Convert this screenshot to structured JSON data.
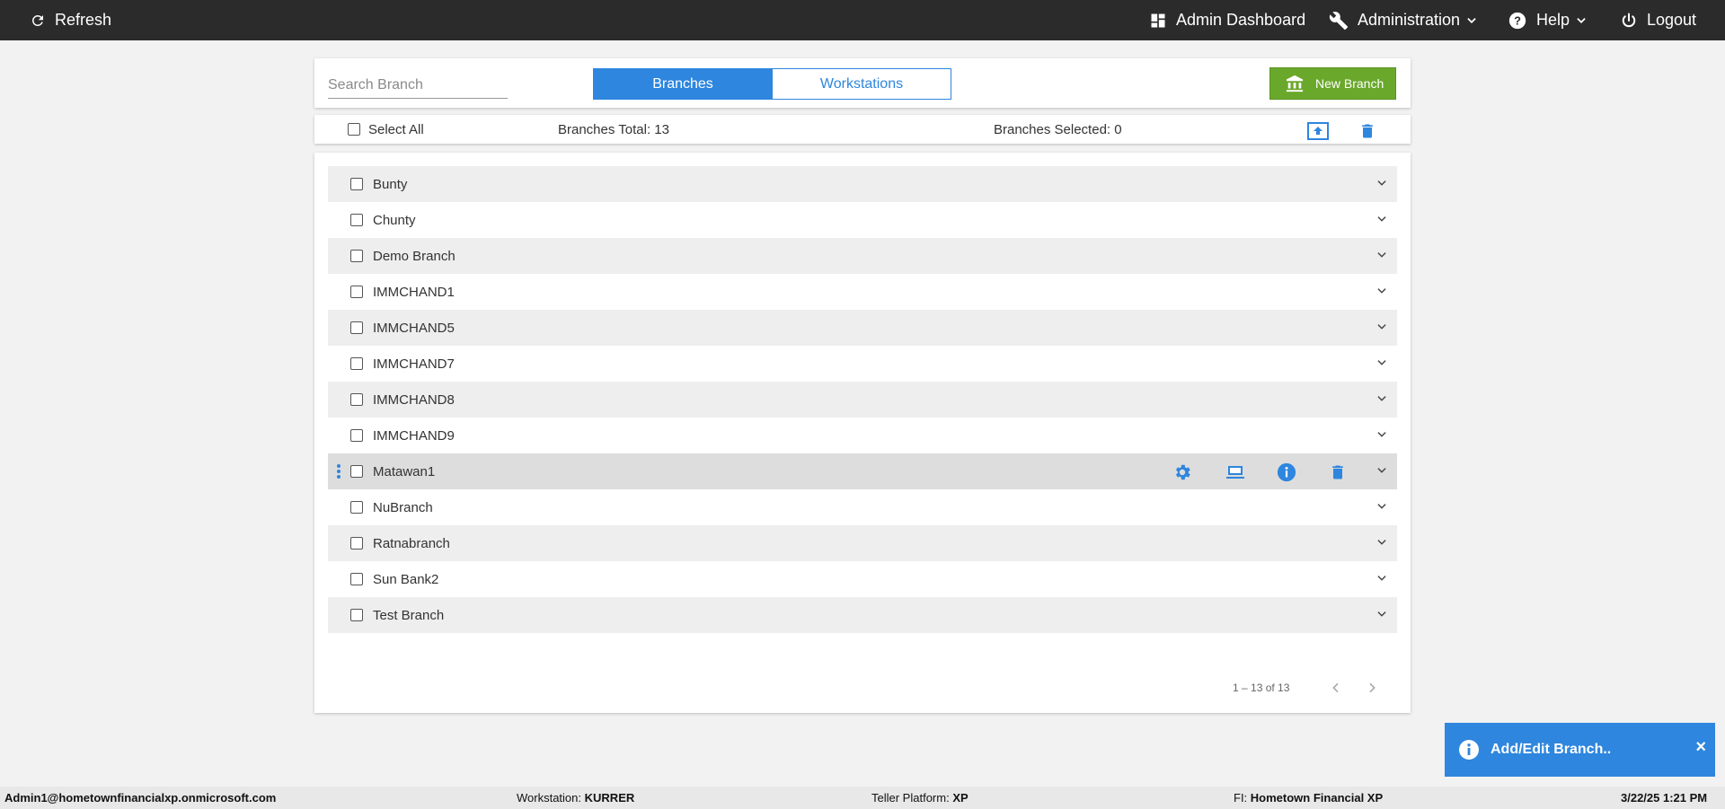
{
  "topbar": {
    "refresh": "Refresh",
    "admin_dashboard": "Admin Dashboard",
    "administration": "Administration",
    "help": "Help",
    "logout": "Logout"
  },
  "toolbar": {
    "search_placeholder": "Search Branch",
    "tab_branches": "Branches",
    "tab_workstations": "Workstations",
    "new_branch": "New Branch"
  },
  "selection": {
    "select_all": "Select All",
    "total": "Branches Total: 13",
    "selected": "Branches Selected: 0"
  },
  "branches": [
    "Bunty",
    "Chunty",
    "Demo Branch",
    "IMMCHAND1",
    "IMMCHAND5",
    "IMMCHAND7",
    "IMMCHAND8",
    "IMMCHAND9",
    "Matawan1",
    "NuBranch",
    "Ratnabranch",
    "Sun Bank2",
    "Test Branch"
  ],
  "pager": {
    "range": "1 – 13 of 13"
  },
  "toast": {
    "message": "Add/Edit Branch..",
    "close": "×"
  },
  "footer": {
    "user": "Admin1@hometownfinancialxp.onmicrosoft.com",
    "workstation_label": "Workstation:",
    "workstation": "KURRER",
    "platform_label": "Teller Platform:",
    "platform": "XP",
    "fi_label": "FI:",
    "fi": "Hometown Financial XP",
    "datetime": "3/22/25 1:21 PM"
  },
  "colors": {
    "accent": "#2e86de",
    "new_button": "#6aa82b",
    "topbar": "#2b2b2b"
  }
}
